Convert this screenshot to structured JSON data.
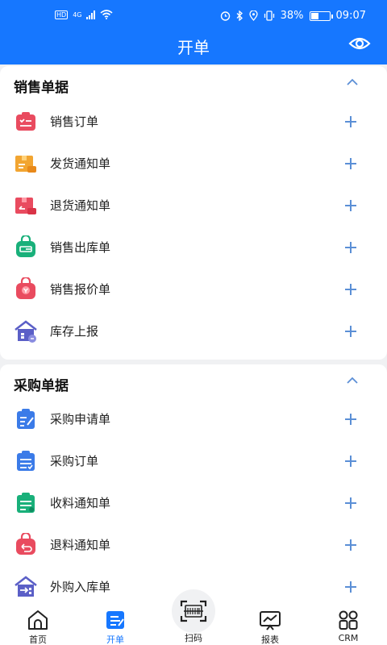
{
  "status": {
    "left_badge": "HD",
    "network": "4G",
    "battery_pct": "38%",
    "time": "09:07"
  },
  "header": {
    "title": "开单"
  },
  "sales": {
    "title": "销售单据",
    "items": [
      {
        "label": "销售订单",
        "icon": "sales-order-icon",
        "color": "#e94b5f"
      },
      {
        "label": "发货通知单",
        "icon": "delivery-notice-icon",
        "color": "#f2a531"
      },
      {
        "label": "退货通知单",
        "icon": "return-notice-icon",
        "color": "#e94b5f"
      },
      {
        "label": "销售出库单",
        "icon": "sales-outbound-icon",
        "color": "#19b07a"
      },
      {
        "label": "销售报价单",
        "icon": "sales-quote-icon",
        "color": "#e94b5f"
      },
      {
        "label": "库存上报",
        "icon": "stock-report-icon",
        "color": "#5b5fc7"
      }
    ]
  },
  "purchase": {
    "title": "采购单据",
    "items": [
      {
        "label": "采购申请单",
        "icon": "purchase-request-icon",
        "color": "#3b7be8"
      },
      {
        "label": "采购订单",
        "icon": "purchase-order-icon",
        "color": "#3b7be8"
      },
      {
        "label": "收料通知单",
        "icon": "receiving-notice-icon",
        "color": "#19b07a"
      },
      {
        "label": "退料通知单",
        "icon": "material-return-icon",
        "color": "#e94b5f"
      },
      {
        "label": "外购入库单",
        "icon": "purchase-inbound-icon",
        "color": "#5b5fc7"
      }
    ]
  },
  "tabs": {
    "home": "首页",
    "order": "开单",
    "scan": "扫码",
    "report": "报表",
    "crm": "CRM"
  },
  "colors": {
    "primary": "#1677ff",
    "plus": "#5b8fd6"
  }
}
